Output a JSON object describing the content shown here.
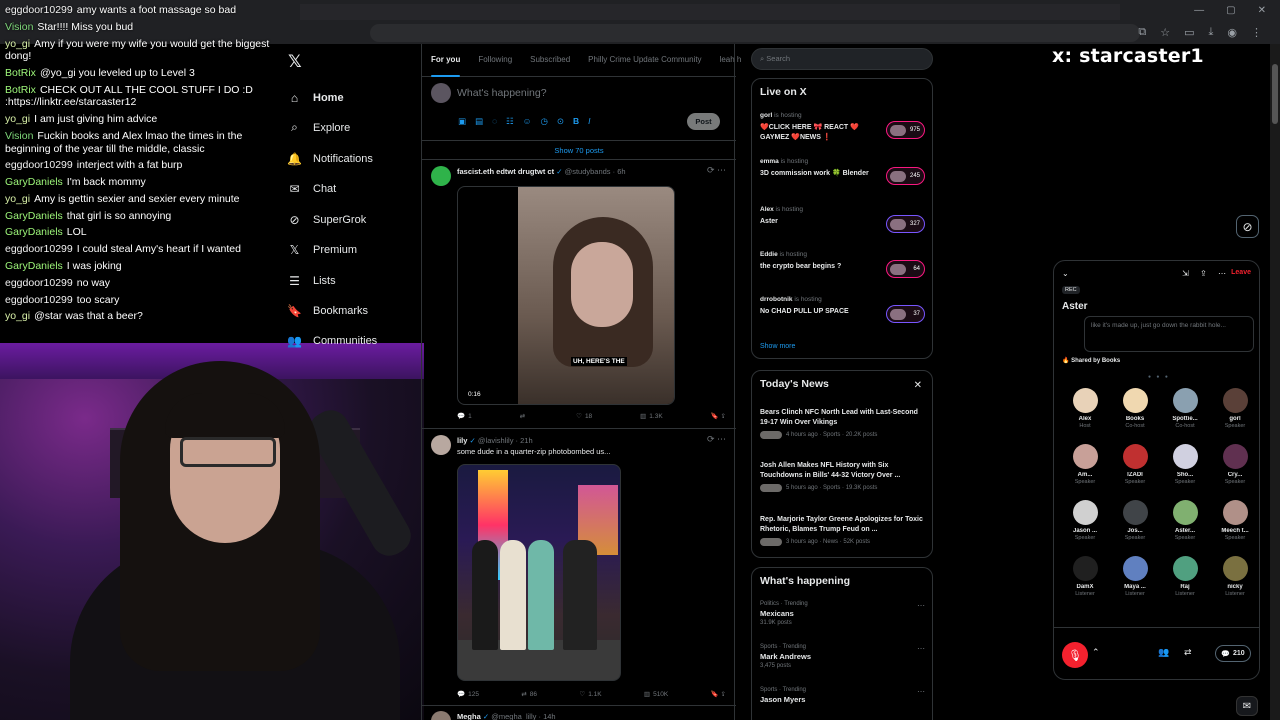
{
  "chat": [
    {
      "user": "eggdoor10299",
      "color": "#f2f2f2",
      "msg": "amy wants a foot massage so bad"
    },
    {
      "user": "Vision",
      "color": "#7fd87a",
      "msg": "Star!!!! Miss you bud"
    },
    {
      "user": "yo_gi",
      "color": "#d8f0a8",
      "msg": "Amy if you were my wife you would get the biggest dong!"
    },
    {
      "user": "BotRix",
      "color": "#9ef77a",
      "msg": "@yo_gi you leveled up to Level 3"
    },
    {
      "user": "BotRix",
      "color": "#9ef77a",
      "msg": "CHECK OUT ALL THE COOL STUFF I DO :D :https://linktr.ee/starcaster12"
    },
    {
      "user": "yo_gi",
      "color": "#d8f0a8",
      "msg": "I am just giving him advice"
    },
    {
      "user": "Vision",
      "color": "#7fd87a",
      "msg": "Fuckin books and Alex lmao the times in the beginning of the year till the middle, classic"
    },
    {
      "user": "eggdoor10299",
      "color": "#f2f2f2",
      "msg": "interject with a fat burp"
    },
    {
      "user": "GaryDaniels",
      "color": "#9ef77a",
      "msg": "I'm back mommy"
    },
    {
      "user": "yo_gi",
      "color": "#d8f0a8",
      "msg": "Amy is gettin sexier and sexier every minute"
    },
    {
      "user": "GaryDaniels",
      "color": "#9ef77a",
      "msg": "that girl is so annoying"
    },
    {
      "user": "GaryDaniels",
      "color": "#9ef77a",
      "msg": "LOL"
    },
    {
      "user": "eggdoor10299",
      "color": "#f2f2f2",
      "msg": "I could steal Amy's heart if I wanted"
    },
    {
      "user": "GaryDaniels",
      "color": "#9ef77a",
      "msg": "I was joking"
    },
    {
      "user": "eggdoor10299",
      "color": "#f2f2f2",
      "msg": "no way"
    },
    {
      "user": "eggdoor10299",
      "color": "#f2f2f2",
      "msg": "too scary"
    },
    {
      "user": "yo_gi",
      "color": "#d8f0a8",
      "msg": "@star was that a beer?"
    }
  ],
  "nav": {
    "items": [
      {
        "label": "Home",
        "icon": "home-icon",
        "glyph": "⌂"
      },
      {
        "label": "Explore",
        "icon": "search-icon",
        "glyph": "⌕"
      },
      {
        "label": "Notifications",
        "icon": "bell-icon",
        "glyph": "🔔"
      },
      {
        "label": "Chat",
        "icon": "mail-icon",
        "glyph": "✉"
      },
      {
        "label": "SuperGrok",
        "icon": "grok-icon",
        "glyph": "⊘"
      },
      {
        "label": "Premium",
        "icon": "x-icon",
        "glyph": "𝕏"
      },
      {
        "label": "Lists",
        "icon": "list-icon",
        "glyph": "☰"
      },
      {
        "label": "Bookmarks",
        "icon": "bookmark-icon",
        "glyph": "🔖"
      },
      {
        "label": "Communities",
        "icon": "people-icon",
        "glyph": "👥"
      }
    ]
  },
  "tabs": [
    "For you",
    "Following",
    "Subscribed",
    "Philly Crime Update Community",
    "leah h"
  ],
  "compose": {
    "placeholder": "What's happening?",
    "post_label": "Post"
  },
  "show_posts": "Show 70 posts",
  "tweets": [
    {
      "name": "fascist.eth edtwt drugtwt ct",
      "handle": "@studybands",
      "time": "6h",
      "text": "",
      "video_caption": "UH, HERE'S THE",
      "video_time": "0:16",
      "replies": "1",
      "reposts": "",
      "likes": "18",
      "views": "1.3K"
    },
    {
      "name": "lily",
      "handle": "@lavishlily",
      "time": "21h",
      "text": "some dude in a quarter-zip photobombed us...",
      "replies": "125",
      "reposts": "86",
      "likes": "1.1K",
      "views": "510K"
    },
    {
      "name": "Megha",
      "handle": "@megha_lilly",
      "time": "14h"
    }
  ],
  "search": {
    "placeholder": "Search"
  },
  "live": {
    "title": "Live on X",
    "hosting_suffix": "is hosting",
    "items": [
      {
        "host": "gorl",
        "title": "❤️CLICK HERE 🎀 REACT ❤️ GAYMEZ ❤️NEWS ❗",
        "count": "975"
      },
      {
        "host": "emma",
        "title": "3D commission work 🍀 Blender",
        "count": "245"
      },
      {
        "host": "Alex",
        "title": "Aster",
        "count": "327"
      },
      {
        "host": "Eddie",
        "title": "the crypto bear begins ?",
        "count": "64"
      },
      {
        "host": "drrobotnik",
        "title": "No CHAD PULL UP SPACE",
        "count": "37"
      }
    ],
    "show_more": "Show more"
  },
  "news": {
    "title": "Today's News",
    "items": [
      {
        "title": "Bears Clinch NFC North Lead with Last-Second 19-17 Win Over Vikings",
        "meta": "4 hours ago · Sports · 20.2K posts"
      },
      {
        "title": "Josh Allen Makes NFL History with Six Touchdowns in Bills' 44-32 Victory Over ...",
        "meta": "5 hours ago · Sports · 19.3K posts"
      },
      {
        "title": "Rep. Marjorie Taylor Greene Apologizes for Toxic Rhetoric, Blames Trump Feud on ...",
        "meta": "3 hours ago · News · 52K posts"
      }
    ]
  },
  "trends": {
    "title": "What's happening",
    "items": [
      {
        "category": "Politics · Trending",
        "name": "Mexicans",
        "count": "31.9K posts"
      },
      {
        "category": "Sports · Trending",
        "name": "Mark Andrews",
        "count": "3,475 posts"
      },
      {
        "category": "Sports · Trending",
        "name": "Jason Myers",
        "count": ""
      }
    ]
  },
  "streamer_title": "x: starcaster1",
  "space": {
    "rec": "REC",
    "name": "Aster",
    "pinned": "like it's made up, just go down the rabbit hole...",
    "leave": "Leave",
    "shared_by": "Shared by Books",
    "listener_count": "210",
    "people": [
      {
        "name": "Alex",
        "role": "Host",
        "color": "#e8d2b8"
      },
      {
        "name": "Books",
        "role": "Co-host",
        "color": "#f0d8b0"
      },
      {
        "name": "Spottie...",
        "role": "Co-host",
        "color": "#8aa0b0"
      },
      {
        "name": "gorl",
        "role": "Speaker",
        "color": "#5a4038"
      },
      {
        "name": "Am...",
        "role": "Speaker",
        "color": "#c8a098"
      },
      {
        "name": "IZADI",
        "role": "Speaker",
        "color": "#c03030"
      },
      {
        "name": "Sho...",
        "role": "Speaker",
        "color": "#d0d0e0"
      },
      {
        "name": "Cry...",
        "role": "Speaker",
        "color": "#603050"
      },
      {
        "name": "Jason ...",
        "role": "Speaker",
        "color": "#d0d0d0"
      },
      {
        "name": "Jos...",
        "role": "Speaker",
        "color": "#404448"
      },
      {
        "name": "Aster...",
        "role": "Speaker",
        "color": "#80b070"
      },
      {
        "name": "Meech t...",
        "role": "Speaker",
        "color": "#b09088"
      },
      {
        "name": "DamX",
        "role": "Listener",
        "color": "#202020"
      },
      {
        "name": "Maya ...",
        "role": "Listener",
        "color": "#6080c0"
      },
      {
        "name": "Raj",
        "role": "Listener",
        "color": "#50a080"
      },
      {
        "name": "nicky",
        "role": "Listener",
        "color": "#7a7040"
      }
    ]
  }
}
